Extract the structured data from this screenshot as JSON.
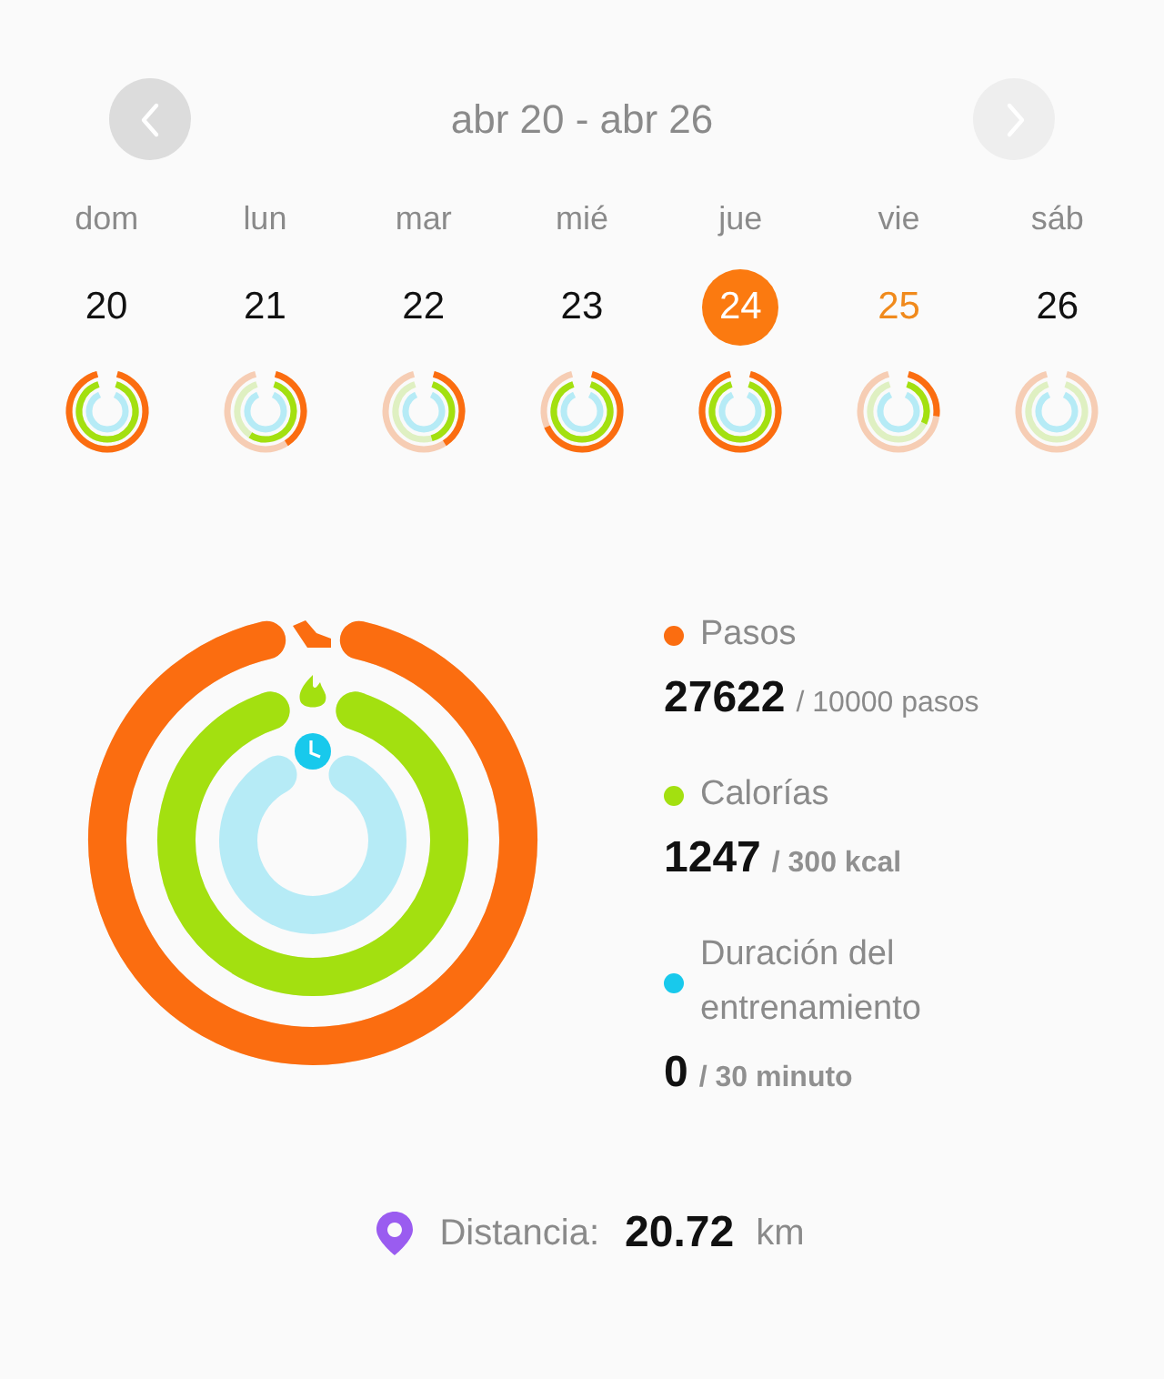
{
  "header": {
    "prev_button": {
      "disabled": false
    },
    "title": "abr 20 - abr 26",
    "next_button": {
      "disabled": true
    }
  },
  "days": [
    {
      "weekday": "dom",
      "date": "20",
      "selected": false,
      "today": false
    },
    {
      "weekday": "lun",
      "date": "21",
      "selected": false,
      "today": false
    },
    {
      "weekday": "mar",
      "date": "22",
      "selected": false,
      "today": false
    },
    {
      "weekday": "mié",
      "date": "23",
      "selected": false,
      "today": false
    },
    {
      "weekday": "jue",
      "date": "24",
      "selected": true,
      "today": false
    },
    {
      "weekday": "vie",
      "date": "25",
      "selected": false,
      "today": true
    },
    {
      "weekday": "sáb",
      "date": "26",
      "selected": false,
      "today": false
    }
  ],
  "summary": {
    "metrics": [
      {
        "kind": "steps",
        "label": "Pasos",
        "value": "27622",
        "goal": "/ 10000 pasos"
      },
      {
        "kind": "calories",
        "label": "Calorías",
        "value": "1247",
        "goal": "/ 300 kcal"
      },
      {
        "kind": "duration",
        "label": "Duración del entrenamiento",
        "value": "0",
        "goal": "/ 30 minuto"
      }
    ]
  },
  "distance": {
    "label": "Distancia:",
    "value": "20.72",
    "unit": "km"
  }
}
